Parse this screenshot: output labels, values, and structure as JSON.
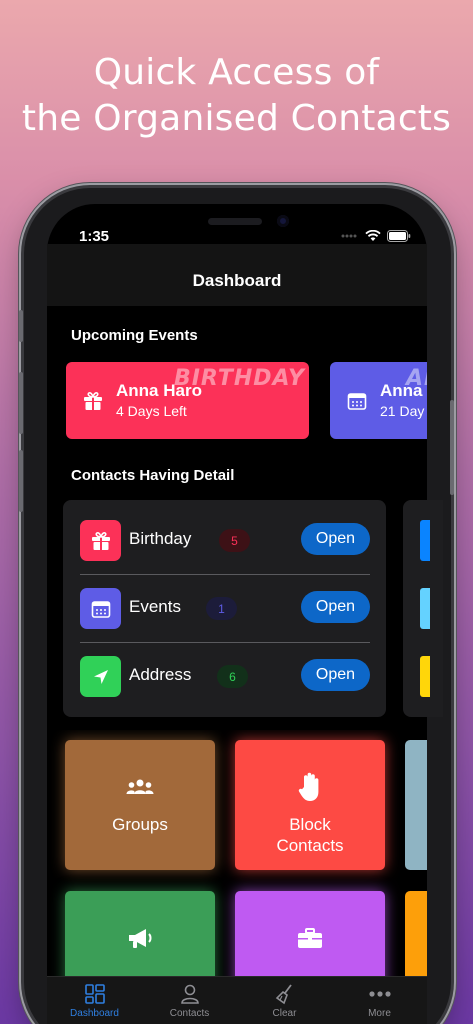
{
  "promo": {
    "line1": "Quick Access of",
    "line2": "the Organised Contacts"
  },
  "status_bar": {
    "time": "1:35"
  },
  "nav": {
    "title": "Dashboard"
  },
  "upcoming": {
    "title": "Upcoming Events",
    "cards": [
      {
        "name": "Anna Haro",
        "sub": "4 Days Left",
        "tag": "BIRTHDAY",
        "color": "#fc3158",
        "icon": "gift-icon"
      },
      {
        "name": "Anna",
        "sub": "21 Day",
        "tag": "AN",
        "color": "#5e5ce6",
        "icon": "calendar-icon"
      }
    ]
  },
  "contacts_detail": {
    "title": "Contacts Having Detail",
    "rows": [
      {
        "label": "Birthday",
        "count": "5",
        "button": "Open",
        "color": "#fc3158",
        "badge_bg": "#3d1116",
        "badge_fg": "#fc3158",
        "icon": "gift-icon"
      },
      {
        "label": "Events",
        "count": "1",
        "button": "Open",
        "color": "#5e5ce6",
        "badge_bg": "#1c1c3a",
        "badge_fg": "#5e5ce6",
        "icon": "calendar-icon"
      },
      {
        "label": "Address",
        "count": "6",
        "button": "Open",
        "color": "#30d158",
        "badge_bg": "#12301a",
        "badge_fg": "#30d158",
        "icon": "location-arrow-icon"
      }
    ]
  },
  "tiles": [
    {
      "label": "Groups",
      "color": "#a2693a",
      "icon": "people-icon"
    },
    {
      "label": "Block\nContacts",
      "color": "#fd4a44",
      "icon": "hand-stop-icon"
    },
    {
      "label": "",
      "color": "#8fb4c3",
      "icon": ""
    },
    {
      "label": "",
      "color": "#3b9e57",
      "icon": "megaphone-icon"
    },
    {
      "label": "",
      "color": "#bf5af2",
      "icon": "briefcase-icon"
    },
    {
      "label": "",
      "color": "#fd9f0a",
      "icon": ""
    }
  ],
  "tabbar": {
    "items": [
      {
        "label": "Dashboard",
        "icon": "dashboard-icon",
        "active": true
      },
      {
        "label": "Contacts",
        "icon": "person-icon",
        "active": false
      },
      {
        "label": "Clear",
        "icon": "broom-icon",
        "active": false
      },
      {
        "label": "More",
        "icon": "more-icon",
        "active": false
      }
    ]
  },
  "colors": {
    "accent_blue": "#0d67c8",
    "tab_active": "#2f7fe0",
    "background_top": "#eba8ad",
    "background_bottom": "#6b38a3"
  }
}
